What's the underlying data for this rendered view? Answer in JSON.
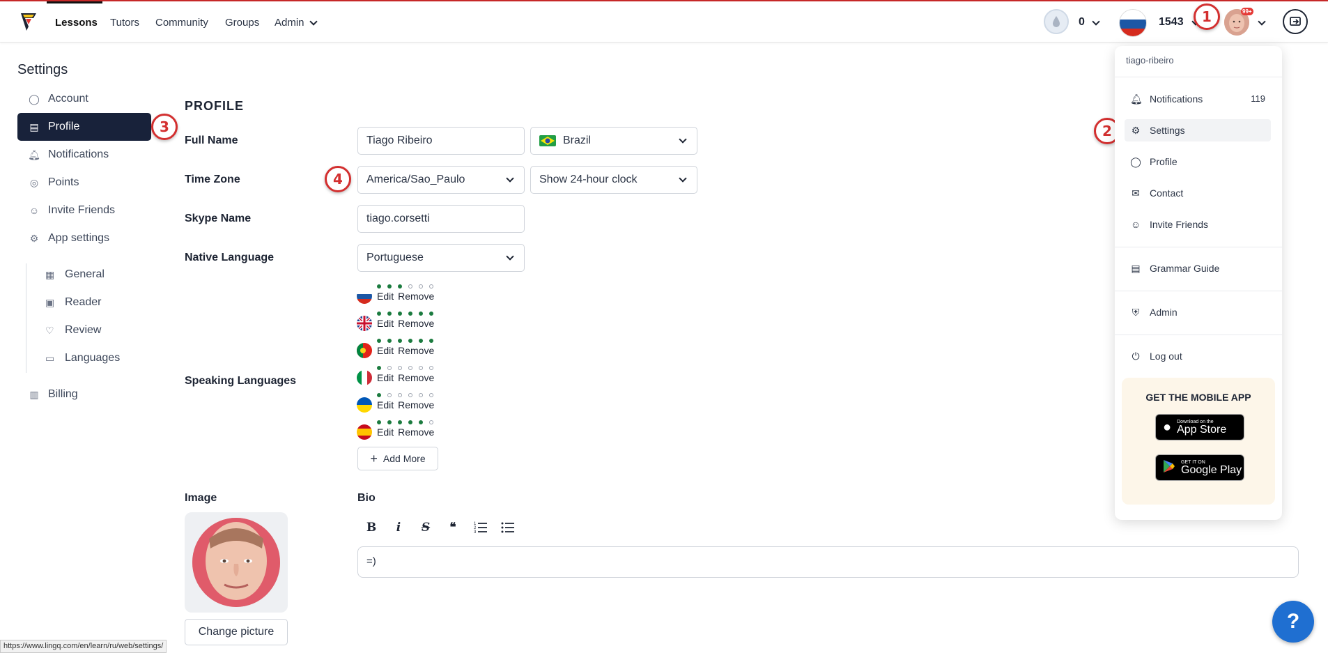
{
  "nav": {
    "tabs": [
      {
        "label": "Lessons"
      },
      {
        "label": "Tutors"
      },
      {
        "label": "Community"
      },
      {
        "label": "Groups"
      },
      {
        "label": "Admin"
      }
    ],
    "streak_count": "0",
    "coins": "1543",
    "avatar_badge": "99+"
  },
  "markers": [
    "1",
    "2",
    "3",
    "4"
  ],
  "sidebar": {
    "title": "Settings",
    "items": [
      {
        "label": "Account",
        "icon": "user-circle-icon"
      },
      {
        "label": "Profile",
        "icon": "id-card-icon"
      },
      {
        "label": "Notifications",
        "icon": "bell-icon"
      },
      {
        "label": "Points",
        "icon": "location-pin-icon"
      },
      {
        "label": "Invite Friends",
        "icon": "invite-icon"
      },
      {
        "label": "App settings",
        "icon": "gear-icon"
      }
    ],
    "sub_items": [
      {
        "label": "General",
        "icon": "newspaper-icon"
      },
      {
        "label": "Reader",
        "icon": "reader-icon"
      },
      {
        "label": "Review",
        "icon": "review-icon"
      },
      {
        "label": "Languages",
        "icon": "chat-icon"
      }
    ],
    "billing": "Billing"
  },
  "profile": {
    "section_title": "PROFILE",
    "full_name_label": "Full Name",
    "full_name_value": "Tiago Ribeiro",
    "country_value": "Brazil",
    "time_zone_label": "Time Zone",
    "time_zone_value": "America/Sao_Paulo",
    "clock_value": "Show 24-hour clock",
    "skype_label": "Skype Name",
    "skype_value": "tiago.corsetti",
    "native_label": "Native Language",
    "native_value": "Portuguese",
    "speaking_label": "Speaking Languages",
    "edit_label": "Edit",
    "remove_label": "Remove",
    "add_more_label": "Add More",
    "speaking_languages": [
      {
        "flag": "russia",
        "level": 3
      },
      {
        "flag": "uk",
        "level": 6
      },
      {
        "flag": "portugal",
        "level": 6
      },
      {
        "flag": "italy",
        "level": 1
      },
      {
        "flag": "ukraine",
        "level": 1
      },
      {
        "flag": "spain",
        "level": 5
      }
    ],
    "image_label": "Image",
    "change_picture_label": "Change picture",
    "bio_label": "Bio",
    "bio_value": "=)",
    "bio_toolbar": [
      "B",
      "i",
      "S",
      "❝",
      "ordered-list-icon",
      "bullet-list-icon"
    ]
  },
  "menu": {
    "username": "tiago-ribeiro",
    "items": [
      {
        "label": "Notifications",
        "count": "119",
        "icon": "bell-icon"
      },
      {
        "label": "Settings",
        "icon": "gear-icon"
      },
      {
        "label": "Profile",
        "icon": "user-circle-icon"
      },
      {
        "label": "Contact",
        "icon": "envelope-icon"
      },
      {
        "label": "Invite Friends",
        "icon": "invite-icon"
      },
      {
        "label": "Grammar Guide",
        "icon": "book-icon"
      },
      {
        "label": "Admin",
        "icon": "shield-icon"
      },
      {
        "label": "Log out",
        "icon": "power-icon"
      }
    ],
    "mobile_title": "GET THE MOBILE APP",
    "app_store_small": "Download on the",
    "app_store_big": "App Store",
    "google_small": "GET IT ON",
    "google_big": "Google Play"
  },
  "status_url": "https://www.lingq.com/en/learn/ru/web/settings/",
  "help_label": "?",
  "colors": {
    "accent_dark": "#18223a",
    "marker_red": "#d32f2f",
    "level_green": "#1b7b3f",
    "help_blue": "#1f6fd1"
  }
}
